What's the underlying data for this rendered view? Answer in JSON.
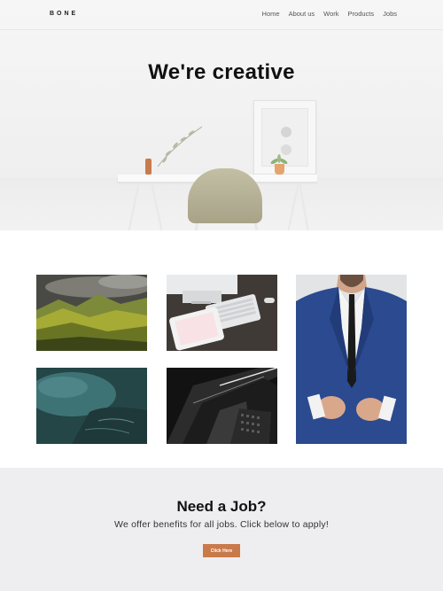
{
  "nav": {
    "logo": "BONE",
    "items": [
      {
        "label": "Home"
      },
      {
        "label": "About us"
      },
      {
        "label": "Work"
      },
      {
        "label": "Products"
      },
      {
        "label": "Jobs"
      }
    ]
  },
  "hero": {
    "title": "We're creative"
  },
  "gallery": {
    "photos": [
      {
        "icon": "mountain-landscape-photo"
      },
      {
        "icon": "desk-keyboard-tablet-photo"
      },
      {
        "icon": "man-in-blue-suit-photo"
      },
      {
        "icon": "aerial-coast-photo"
      },
      {
        "icon": "dark-skyscraper-photo"
      }
    ]
  },
  "cta": {
    "title": "Need a Job?",
    "subtitle": "We offer benefits for all jobs. Click below to apply!",
    "button_label": "Click Here"
  },
  "colors": {
    "accent": "#c97a4a",
    "cta_background": "#eeeef0",
    "hero_background": "#f3f3f3"
  }
}
